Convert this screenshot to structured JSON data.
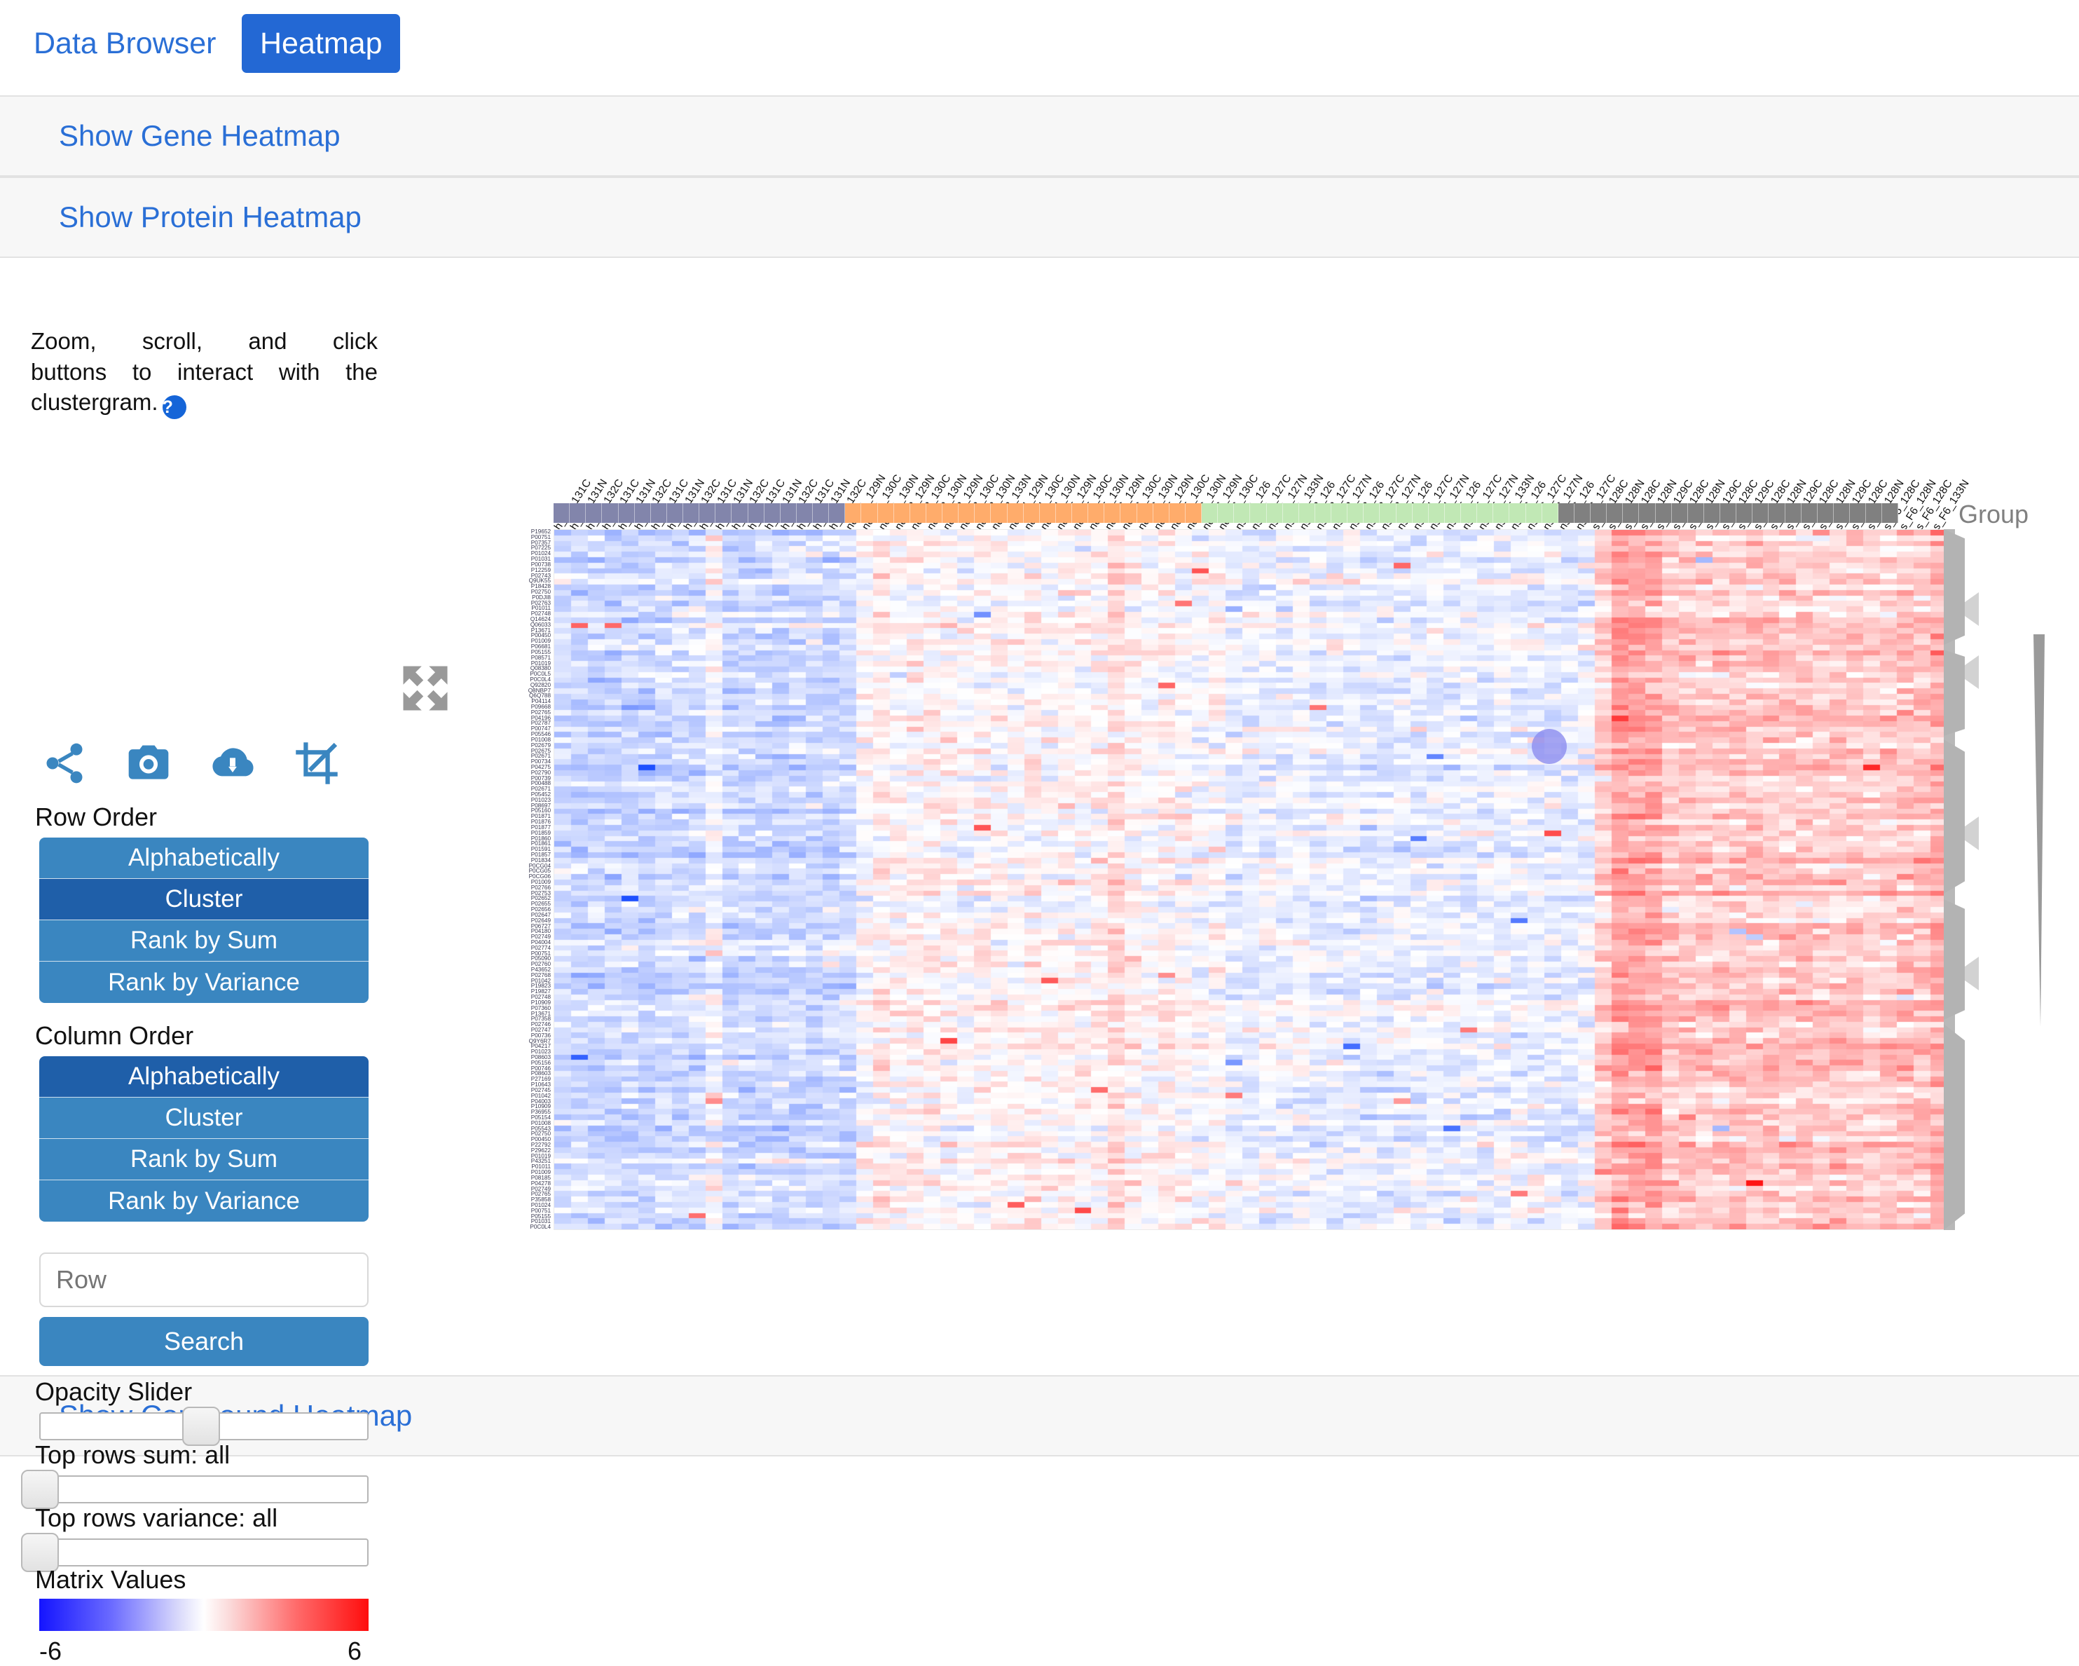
{
  "tabs": [
    {
      "label": "Data Browser",
      "active": false
    },
    {
      "label": "Heatmap",
      "active": true
    }
  ],
  "accordions": [
    {
      "label": "Show Gene Heatmap"
    },
    {
      "label": "Show Protein Heatmap"
    },
    {
      "label": "Show Compound Heatmap"
    }
  ],
  "controls": {
    "hint_line1": "Zoom, scroll, and click",
    "hint_line2": "buttons to interact with the",
    "hint_line3": "clustergram.",
    "help_glyph": "?",
    "icons": [
      "share-icon",
      "camera-icon",
      "cloud-download-icon",
      "crop-icon"
    ],
    "expand_icon": "expand-arrows-icon",
    "row_order": {
      "label": "Row Order",
      "options": [
        "Alphabetically",
        "Cluster",
        "Rank by Sum",
        "Rank by Variance"
      ],
      "selected": "Cluster"
    },
    "column_order": {
      "label": "Column Order",
      "options": [
        "Alphabetically",
        "Cluster",
        "Rank by Sum",
        "Rank by Variance"
      ],
      "selected": "Alphabetically"
    },
    "search": {
      "placeholder": "Row",
      "value": "",
      "button_label": "Search"
    },
    "opacity_slider": {
      "label": "Opacity Slider",
      "position_pct": 46
    },
    "top_rows_sum": {
      "label": "Top rows sum: all",
      "position_pct": 0
    },
    "top_rows_variance": {
      "label": "Top rows variance: all",
      "position_pct": 0
    },
    "matrix_values": {
      "label": "Matrix Values",
      "min": "-6",
      "max": "6",
      "low_color": "#0d0dff",
      "mid_color": "#ffffff",
      "high_color": "#ff0000"
    }
  },
  "clustergram": {
    "group_caption": "Group",
    "groups": [
      {
        "name": "h",
        "color": "#8285ab",
        "count": 18
      },
      {
        "name": "nc",
        "color": "#ffac6b",
        "count": 22
      },
      {
        "name": "ns",
        "color": "#c1e8b5",
        "count": 22
      },
      {
        "name": "s",
        "color": "#808080",
        "count": 21
      }
    ],
    "col_labels": [
      "h_F1_131C",
      "h_F1_131N",
      "h_F1_132C",
      "h_F2_131C",
      "h_F2_131N",
      "h_F2_132C",
      "h_F3_131C",
      "h_F3_131N",
      "h_F3_132C",
      "h_F4_131C",
      "h_F4_131N",
      "h_F4_132C",
      "h_F5_131C",
      "h_F5_131N",
      "h_F5_132C",
      "h_F6_131C",
      "h_F6_131N",
      "h_F6_132C",
      "nc_F1_129N",
      "nc_F1_130C",
      "nc_F1_130N",
      "nc_F2_129N",
      "nc_F2_130C",
      "nc_F2_130N",
      "nc_F3_129N",
      "nc_F3_130C",
      "nc_F3_130N",
      "nc_F3_133N",
      "nc_F4_129N",
      "nc_F4_130C",
      "nc_F4_130N",
      "nc_F5_129N",
      "nc_F5_130C",
      "nc_F5_130N",
      "nc_F6_129N",
      "nc_F6_130C",
      "nc_F6_130N",
      "nc_F5_129N",
      "nc_F5_130C",
      "nc_F6_130N",
      "nc_F6_129N",
      "nc_F6_130C",
      "ns_F1_126",
      "ns_F1_127C",
      "ns_F1_127N",
      "ns_F1_133N",
      "ns_F2_126",
      "ns_F2_127C",
      "ns_F2_127N",
      "ns_F3_126",
      "ns_F3_127C",
      "ns_F3_127N",
      "ns_F4_126",
      "ns_F4_127C",
      "ns_F4_127N",
      "ns_F5_126",
      "ns_F5_127C",
      "ns_F5_127N",
      "ns_F5_133N",
      "ns_F6_126",
      "ns_F6_127C",
      "ns_F6_127N",
      "ns_F6_126",
      "ns_F6_127C",
      "s_F1_128C",
      "s_F1_128N",
      "s_F2_128C",
      "s_F2_128N",
      "s_F3_129C",
      "s_F3_128C",
      "s_F3_128N",
      "s_F4_129C",
      "s_F4_128C",
      "s_F5_129C",
      "s_F5_128C",
      "s_F5_128N",
      "s_F3_129C",
      "s_F3_128C",
      "s_F3_128N",
      "s_F4_129C",
      "s_F4_128C",
      "s_F5_128N",
      "s_F5_128C",
      "s_F6_128N",
      "s_F6_128C",
      "s_F6_133N"
    ],
    "row_labels": [
      "P19652",
      "P00751",
      "P07357",
      "P07225",
      "P01024",
      "P01031",
      "P00738",
      "P12259",
      "P02743",
      "Q9UK55",
      "P18428",
      "P02750",
      "P0DJI8",
      "P02763",
      "P01011",
      "P02748",
      "Q14624",
      "Q06033",
      "P13671",
      "P00450",
      "P01009",
      "P06681",
      "P05155",
      "P08571",
      "P01019",
      "Q08380",
      "P0C0L5",
      "P0C0L4",
      "Q92820",
      "Q8NBP7",
      "Q6Q788",
      "P04114",
      "P09668",
      "P02765",
      "P04196",
      "P02787",
      "P00747",
      "P05546",
      "P01008",
      "P02679",
      "P02675",
      "P02671",
      "P00734",
      "P04275",
      "P02790",
      "P00739",
      "P00488",
      "P02671",
      "P05452",
      "P01023",
      "P08697",
      "P05160",
      "P01871",
      "P01876",
      "P01877",
      "P01859",
      "P01860",
      "P01861",
      "P01591",
      "P01857",
      "P01834",
      "P0CG04",
      "P0CG05",
      "P0CG06",
      "P01009",
      "P02766",
      "P02753",
      "P02652",
      "P02655",
      "P02656",
      "P02647",
      "P02649",
      "P06727",
      "P04180",
      "P02749",
      "P04004",
      "P02774",
      "P00751",
      "P05090",
      "P02760",
      "P43652",
      "P02768",
      "P01042",
      "P19823",
      "P19827",
      "P02748",
      "P10909",
      "P07360",
      "P13671",
      "P07358",
      "P02746",
      "P02747",
      "P00736",
      "Q9Y6R7",
      "P04217",
      "P01023",
      "P08603",
      "P05156",
      "P00746",
      "P08603",
      "P27169",
      "P10643",
      "P02745",
      "P01042",
      "P04003",
      "P10909",
      "P36955",
      "P05154",
      "P01008",
      "P05543",
      "P02750",
      "P00450",
      "P22792",
      "P29622",
      "P01019",
      "P43251",
      "P01011",
      "P01009",
      "P08185",
      "P04278",
      "P02749",
      "P02765",
      "P35858",
      "P01024",
      "P00751",
      "P05155",
      "P01031",
      "P0C0L4"
    ],
    "matrix_seed": 20240717,
    "n_rows": 128,
    "n_cols": 83,
    "value_range": [
      -6,
      6
    ]
  }
}
